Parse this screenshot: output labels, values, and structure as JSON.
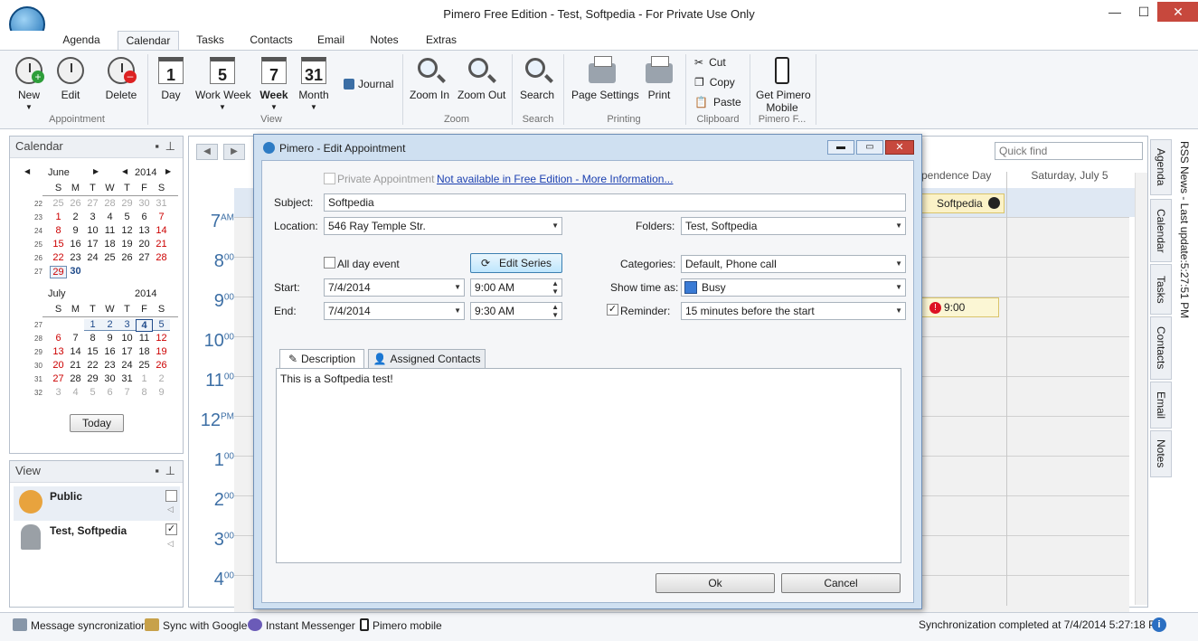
{
  "window": {
    "title": "Pimero Free Edition - Test, Softpedia - For Private Use Only",
    "min": "—",
    "max": "☐",
    "close": "✕"
  },
  "tabs": [
    "Agenda",
    "Calendar",
    "Tasks",
    "Contacts",
    "Email",
    "Notes",
    "Extras"
  ],
  "ribbon": {
    "new": "New",
    "edit": "Edit",
    "delete": "Delete",
    "day": "Day",
    "day_num": "1",
    "work_week": "Work Week",
    "work_week_num": "5",
    "week": "Week",
    "week_num": "7",
    "month": "Month",
    "month_num": "31",
    "journal": "Journal",
    "zoom_in": "Zoom In",
    "zoom_out": "Zoom Out",
    "search": "Search",
    "page_settings": "Page Settings",
    "print": "Print",
    "cut": "Cut",
    "copy": "Copy",
    "paste": "Paste",
    "get_mobile_1": "Get Pimero",
    "get_mobile_2": "Mobile",
    "groups": {
      "appointment": "Appointment",
      "view": "View",
      "zoom": "Zoom",
      "search": "Search",
      "printing": "Printing",
      "clipboard": "Clipboard",
      "pimero": "Pimero F..."
    }
  },
  "calendar_panel": {
    "title": "Calendar",
    "june": {
      "month": "June",
      "year": "2014"
    },
    "july": {
      "month": "July",
      "year": "2014"
    },
    "weekdays": [
      "S",
      "M",
      "T",
      "W",
      "T",
      "F",
      "S"
    ],
    "june_weeks": [
      {
        "wk": "22",
        "days": [
          "25",
          "26",
          "27",
          "28",
          "29",
          "30",
          "31"
        ]
      },
      {
        "wk": "23",
        "days": [
          "1",
          "2",
          "3",
          "4",
          "5",
          "6",
          "7"
        ]
      },
      {
        "wk": "24",
        "days": [
          "8",
          "9",
          "10",
          "11",
          "12",
          "13",
          "14"
        ]
      },
      {
        "wk": "25",
        "days": [
          "15",
          "16",
          "17",
          "18",
          "19",
          "20",
          "21"
        ]
      },
      {
        "wk": "26",
        "days": [
          "22",
          "23",
          "24",
          "25",
          "26",
          "27",
          "28"
        ]
      },
      {
        "wk": "27",
        "days": [
          "29",
          "30",
          "",
          "",
          "",
          "",
          ""
        ]
      }
    ],
    "july_weeks": [
      {
        "wk": "27",
        "days": [
          "",
          "",
          "1",
          "2",
          "3",
          "4",
          "5"
        ]
      },
      {
        "wk": "28",
        "days": [
          "6",
          "7",
          "8",
          "9",
          "10",
          "11",
          "12"
        ]
      },
      {
        "wk": "29",
        "days": [
          "13",
          "14",
          "15",
          "16",
          "17",
          "18",
          "19"
        ]
      },
      {
        "wk": "30",
        "days": [
          "20",
          "21",
          "22",
          "23",
          "24",
          "25",
          "26"
        ]
      },
      {
        "wk": "31",
        "days": [
          "27",
          "28",
          "29",
          "30",
          "31",
          "1",
          "2"
        ]
      },
      {
        "wk": "32",
        "days": [
          "3",
          "4",
          "5",
          "6",
          "7",
          "8",
          "9"
        ]
      }
    ],
    "today_button": "Today"
  },
  "view_panel": {
    "title": "View",
    "items": [
      {
        "label": "Public",
        "checked": false
      },
      {
        "label": "Test, Softpedia",
        "checked": true
      }
    ]
  },
  "calendar_view": {
    "quick_find_placeholder": "Quick find",
    "day_header_partial": "pendence Day",
    "day_header_sat": "Saturday, July 5",
    "event_title": "Softpedia",
    "reminder_time": "9:00",
    "hours": [
      {
        "h": "7",
        "s": "AM"
      },
      {
        "h": "8",
        "s": "00"
      },
      {
        "h": "9",
        "s": "00"
      },
      {
        "h": "10",
        "s": "00"
      },
      {
        "h": "11",
        "s": "00"
      },
      {
        "h": "12",
        "s": "PM"
      },
      {
        "h": "1",
        "s": "00"
      },
      {
        "h": "2",
        "s": "00"
      },
      {
        "h": "3",
        "s": "00"
      },
      {
        "h": "4",
        "s": "00"
      }
    ]
  },
  "side_tabs": [
    "Agenda",
    "Calendar",
    "Tasks",
    "Contacts",
    "Email",
    "Notes"
  ],
  "rss": "RSS News - Last update:5:27:51 PM",
  "status": {
    "msg_sync": "Message syncronization",
    "google": "Sync with Google",
    "im": "Instant Messenger",
    "mobile": "Pimero mobile",
    "sync_done": "Synchronization completed at 7/4/2014 5:27:18 PM"
  },
  "dialog": {
    "title": "Pimero - Edit Appointment",
    "private_label": "Private Appointment",
    "free_link": "Not available in Free Edition - More Information...",
    "subject_label": "Subject:",
    "subject": "Softpedia",
    "location_label": "Location:",
    "location": "546 Ray Temple Str.",
    "folders_label": "Folders:",
    "folders": "Test, Softpedia",
    "all_day_label": "All day event",
    "edit_series": "Edit Series",
    "categories_label": "Categories:",
    "categories": "Default, Phone call",
    "start_label": "Start:",
    "start_date": "7/4/2014",
    "start_time": "9:00 AM",
    "show_time_label": "Show time as:",
    "show_time": "Busy",
    "end_label": "End:",
    "end_date": "7/4/2014",
    "end_time": "9:30 AM",
    "reminder_label": "Reminder:",
    "reminder": "15 minutes before the start",
    "tab_description": "Description",
    "tab_contacts": "Assigned Contacts",
    "description": "This is a Softpedia test!",
    "ok": "Ok",
    "cancel": "Cancel",
    "busy_color": "#3a7bd5"
  }
}
